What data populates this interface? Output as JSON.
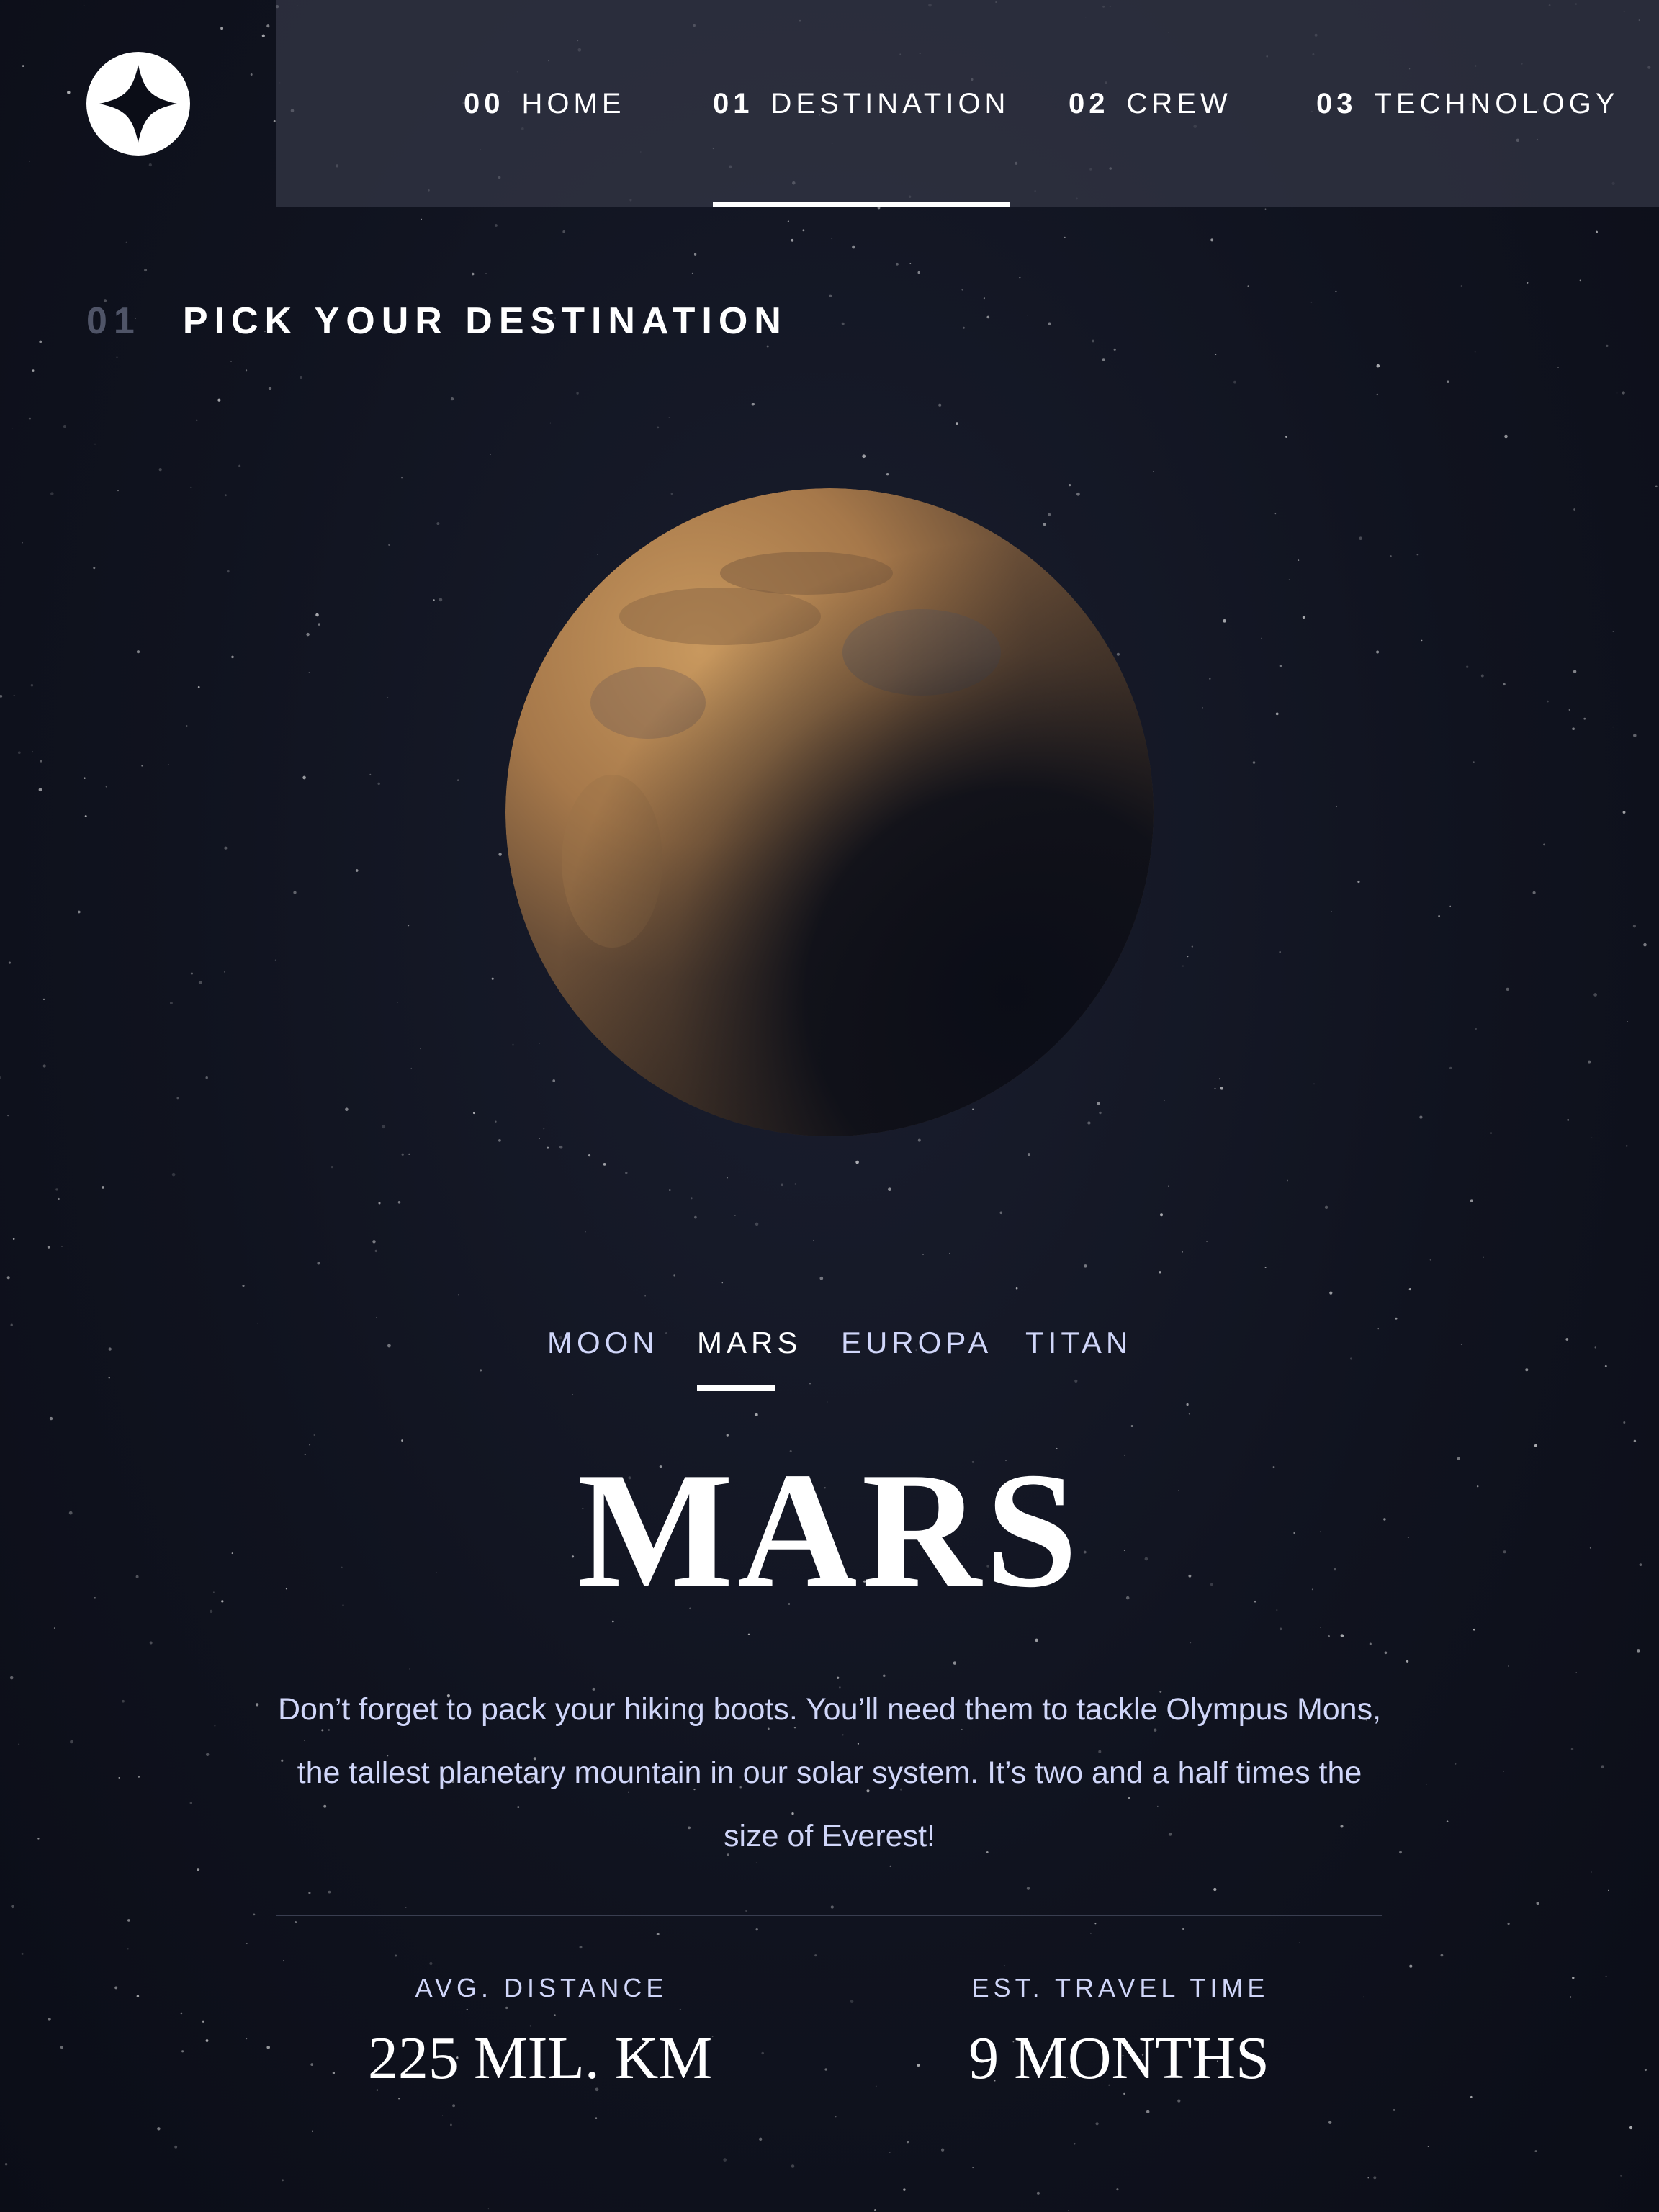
{
  "nav": {
    "items": [
      {
        "num": "00",
        "label": "HOME"
      },
      {
        "num": "01",
        "label": "DESTINATION"
      },
      {
        "num": "02",
        "label": "CREW"
      },
      {
        "num": "03",
        "label": "TECHNOLOGY"
      }
    ],
    "active_index": 1
  },
  "heading": {
    "num": "01",
    "text": "PICK YOUR DESTINATION"
  },
  "destination_tabs": [
    "MOON",
    "MARS",
    "EUROPA",
    "TITAN"
  ],
  "active_tab_index": 1,
  "destination": {
    "name": "MARS",
    "description": "Don’t forget to pack your hiking boots. You’ll need them to tackle Olympus Mons, the tallest planetary mountain in our solar system. It’s two and a half times the size of Everest!",
    "stats": [
      {
        "label": "AVG. DISTANCE",
        "value": "225 MIL. KM"
      },
      {
        "label": "EST. TRAVEL TIME",
        "value": "9 MONTHS"
      }
    ]
  },
  "colors": {
    "background": "#0b0d17",
    "text_light": "#d0d6f9",
    "white": "#ffffff",
    "nav_bg": "#343846"
  },
  "icons": {
    "logo": "four-point-star-icon",
    "planet": "mars-planet-image"
  }
}
